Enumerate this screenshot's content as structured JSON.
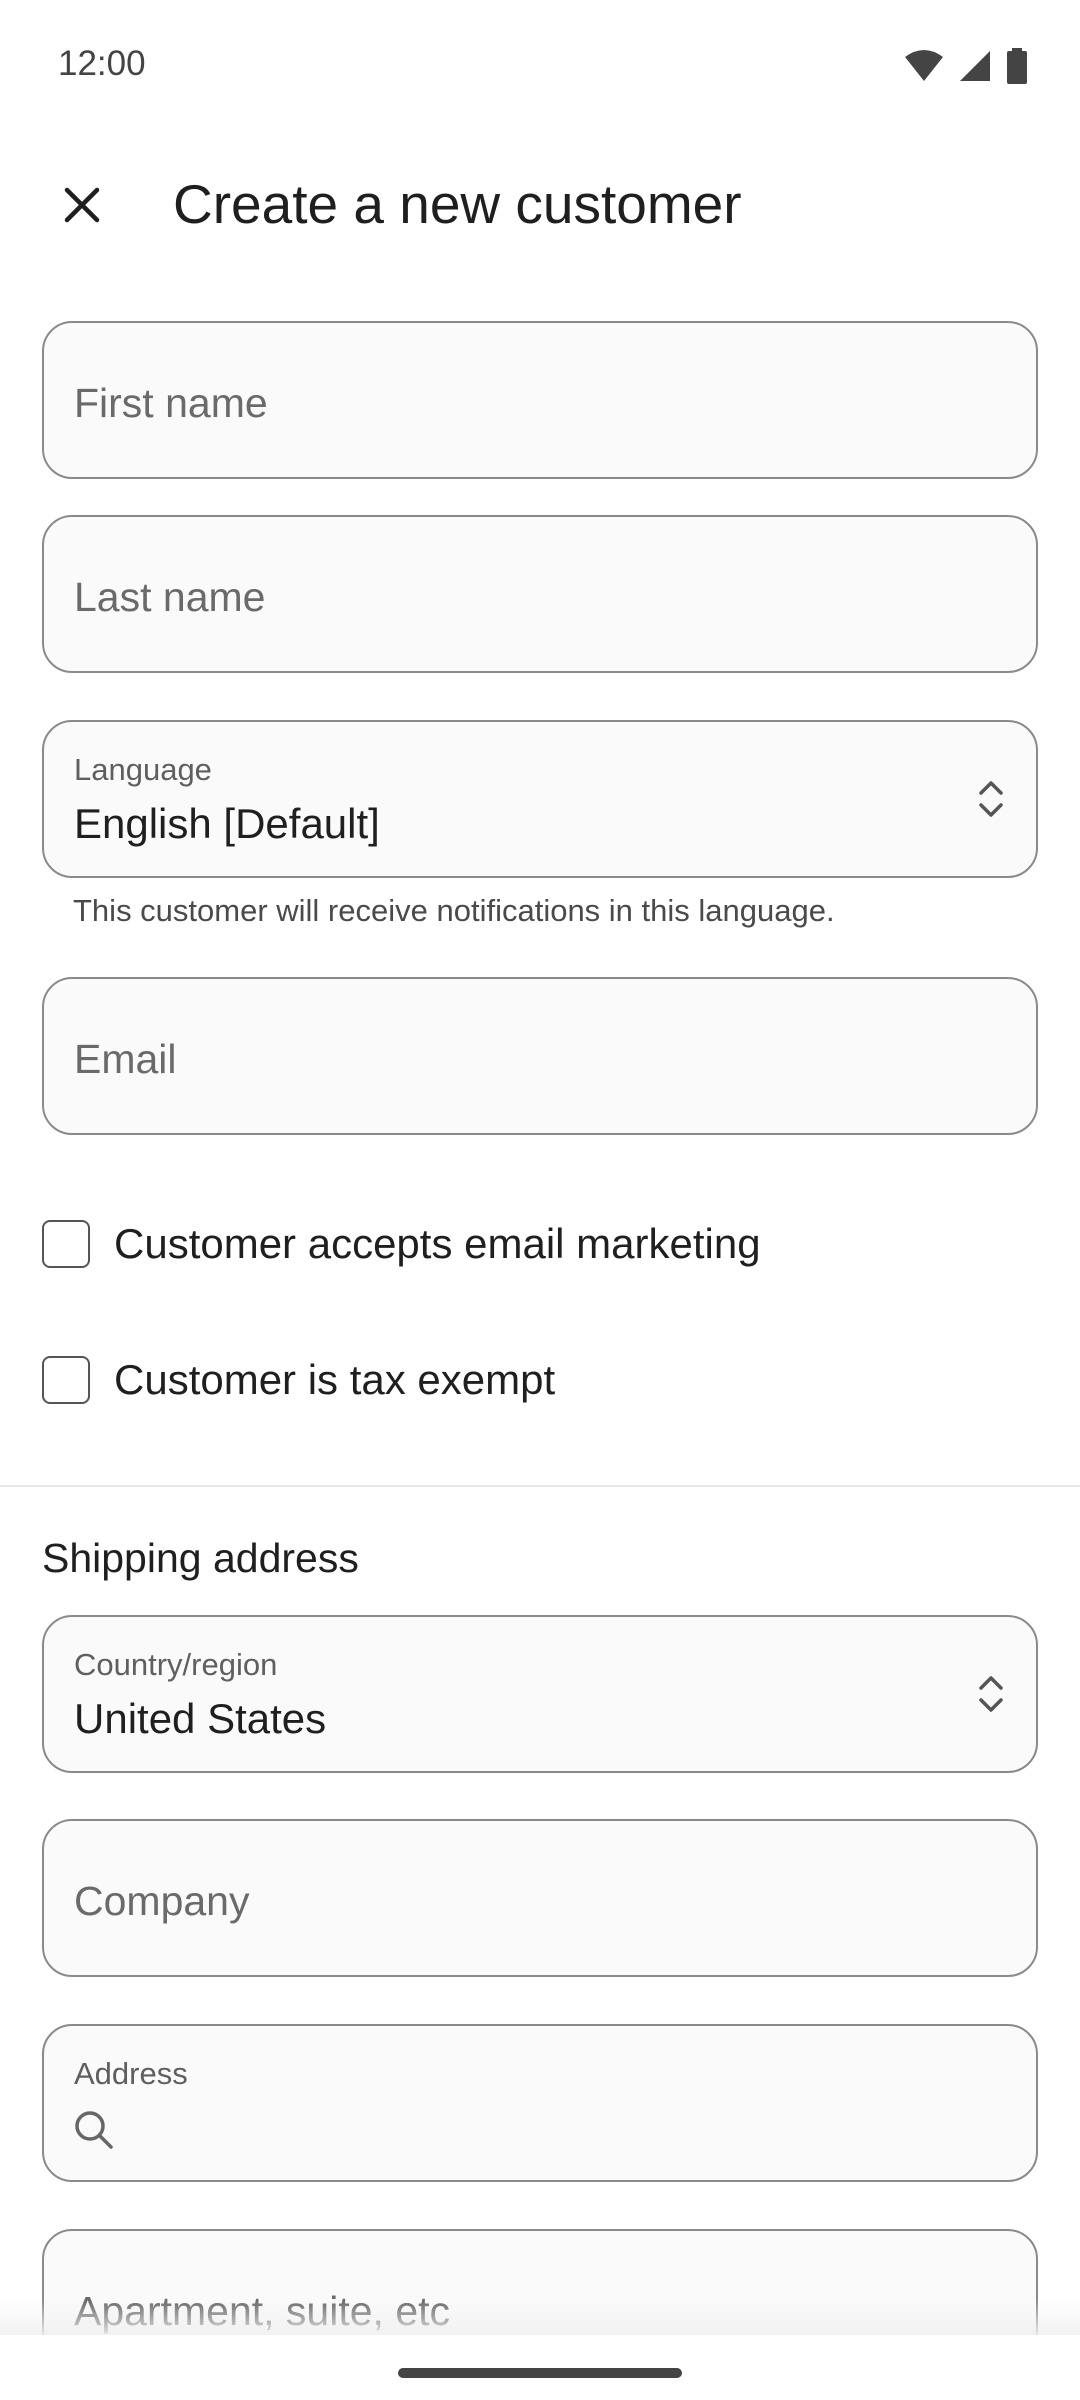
{
  "status_bar": {
    "time": "12:00",
    "icons": [
      "wifi-icon",
      "signal-icon",
      "battery-icon"
    ]
  },
  "header": {
    "close_icon": "close-icon",
    "title": "Create a new customer"
  },
  "form": {
    "first_name": {
      "placeholder": "First name",
      "value": ""
    },
    "last_name": {
      "placeholder": "Last name",
      "value": ""
    },
    "language": {
      "label": "Language",
      "value": "English [Default]",
      "helper": "This customer will receive notifications in this language."
    },
    "email": {
      "placeholder": "Email",
      "value": ""
    },
    "checkboxes": [
      {
        "label": "Customer accepts email marketing",
        "checked": false
      },
      {
        "label": "Customer is tax exempt",
        "checked": false
      }
    ]
  },
  "shipping": {
    "section_title": "Shipping address",
    "country": {
      "label": "Country/region",
      "value": "United States"
    },
    "company": {
      "placeholder": "Company",
      "value": ""
    },
    "address": {
      "label": "Address",
      "value": ""
    },
    "apartment": {
      "placeholder": "Apartment, suite, etc",
      "value": ""
    }
  },
  "colors": {
    "border": "#8a8a8a",
    "field_background": "#fafafa",
    "text_primary": "#1f1f1f",
    "text_secondary": "#6a6a6a"
  }
}
